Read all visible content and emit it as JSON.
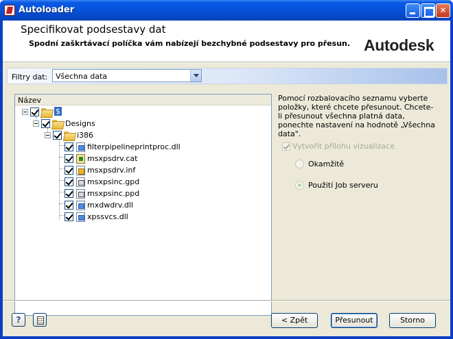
{
  "window": {
    "title": "Autoloader"
  },
  "header": {
    "title": "Specifikovat podsestavy dat",
    "subtitle": "Spodní zaškrtávací políčka vám nabízejí bezchybné podsestavy pro přesun.",
    "brand": "Autodesk"
  },
  "filter": {
    "label": "Filtry dat:",
    "value": "Všechna data"
  },
  "tree": {
    "column_header": "Název",
    "root_label": "$",
    "folder1": "Designs",
    "folder2": "i386",
    "files": [
      "filterpipelineprintproc.dll",
      "msxpsdrv.cat",
      "msxpsdrv.inf",
      "msxpsinc.gpd",
      "msxpsinc.ppd",
      "mxdwdrv.dll",
      "xpssvcs.dll"
    ]
  },
  "description": "Pomocí rozbalovacího seznamu vyberte položky, které chcete přesunout. Chcete-li přesunout všechna platná data, ponechte nastavení na hodnotě „Všechna data\".",
  "options": {
    "visualization_label": "Vytvořit přílohu vizualizace",
    "immediate_label": "Okamžitě",
    "jobserver_label": "Použití Job serveru"
  },
  "buttons": {
    "help": "?",
    "back": "< Zpět",
    "next": "Přesunout",
    "cancel": "Storno"
  }
}
